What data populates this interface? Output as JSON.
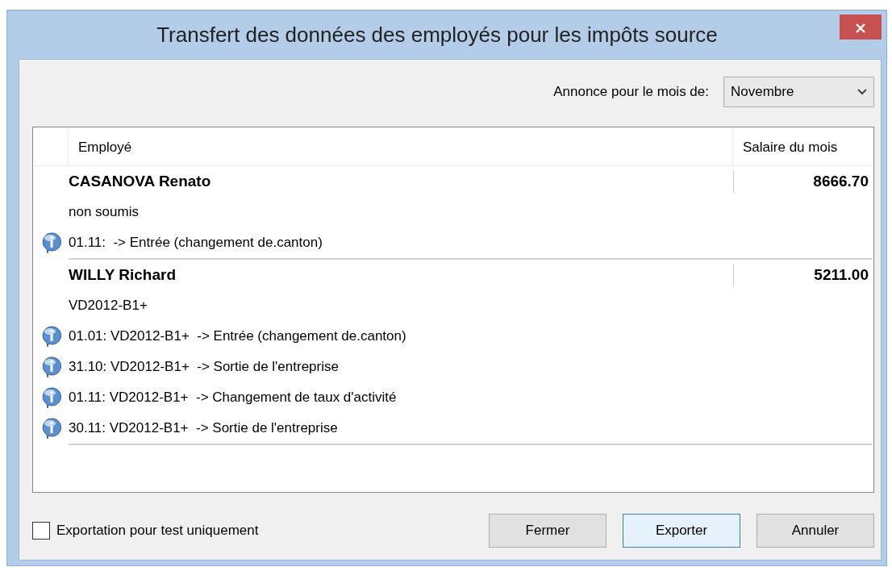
{
  "window": {
    "title": "Transfert des données des employés pour les impôts source"
  },
  "month": {
    "label": "Annonce pour le mois de:",
    "value": "Novembre"
  },
  "table": {
    "columns": [
      "Employé",
      "Salaire du mois"
    ],
    "employees": [
      {
        "name": "CASANOVA Renato",
        "salary": "8666.70",
        "status": "non soumis",
        "events": [
          "01.11:  -> Entrée (changement de.canton)"
        ]
      },
      {
        "name": "WILLY Richard",
        "salary": "5211.00",
        "status": "VD2012-B1+",
        "events": [
          "01.01: VD2012-B1+  -> Entrée (changement de.canton)",
          "31.10: VD2012-B1+  -> Sortie de l'entreprise",
          "01.11: VD2012-B1+  -> Changement de taux d'activité",
          "30.11: VD2012-B1+  -> Sortie de l'entreprise"
        ]
      }
    ]
  },
  "export_test": {
    "label": "Exportation pour test uniquement",
    "checked": false
  },
  "buttons": [
    {
      "label": "Fermer",
      "default": false
    },
    {
      "label": "Exporter",
      "default": true
    },
    {
      "label": "Annuler",
      "default": false
    }
  ]
}
